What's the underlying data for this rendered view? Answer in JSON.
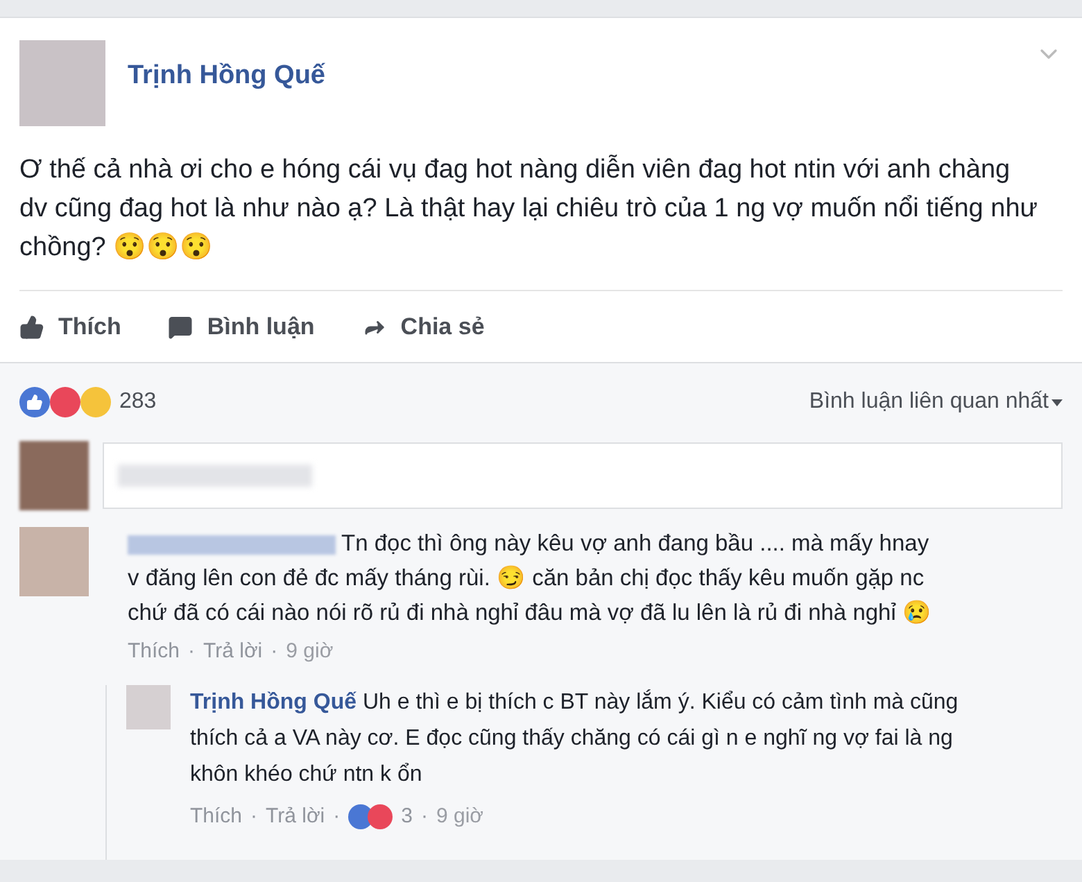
{
  "post": {
    "author": "Trịnh Hồng Quế",
    "text": "Ơ thế cả nhà ơi cho e hóng cái vụ đag hot nàng diễn viên đag hot ntin với anh chàng dv cũng đag hot là như nào ạ? Là thật hay lại chiêu trò của 1 ng vợ muốn nổi tiếng như chồng? 😯😯😯"
  },
  "actions": [
    {
      "label": "Thích",
      "kind": "like"
    },
    {
      "label": "Bình luận",
      "kind": "comment"
    },
    {
      "label": "Chia sẻ",
      "kind": "share"
    }
  ],
  "reactions": {
    "count": "283",
    "sort": "Bình luận liên quan nhất"
  },
  "comments": [
    {
      "text": "Tn đọc thì ông này kêu vợ anh đang bầu .... mà mấy hnay v đăng lên con đẻ đc mấy tháng rùi. 😏 căn bản chị đọc thấy kêu muốn gặp nc chứ đã có cái nào nói rõ rủ đi nhà nghỉ đâu mà vợ đã lu lên là rủ đi nhà nghỉ 😢",
      "meta": [
        {
          "kind": "link",
          "text": "Thích"
        },
        {
          "kind": "sep",
          "text": "·"
        },
        {
          "kind": "link",
          "text": "Trả lời"
        },
        {
          "kind": "sep",
          "text": "·"
        },
        {
          "kind": "time",
          "text": "9 giờ"
        }
      ],
      "replies": [
        {
          "author": "Trịnh Hồng Quế",
          "text": "Uh e thì e bị thích c BT này lắm ý. Kiểu có cảm tình mà cũng thích cả a VA này cơ. E đọc cũng thấy chăng có cái gì n e nghĩ ng vợ fai là ng khôn khéo chứ ntn k ổn",
          "meta": [
            {
              "kind": "link",
              "text": "Thích"
            },
            {
              "kind": "sep",
              "text": "·"
            },
            {
              "kind": "link",
              "text": "Trả lời"
            },
            {
              "kind": "sep",
              "text": "·"
            },
            {
              "kind": "reactions",
              "text": "3"
            },
            {
              "kind": "sep",
              "text": "·"
            },
            {
              "kind": "time",
              "text": "9 giờ"
            }
          ]
        }
      ]
    }
  ]
}
